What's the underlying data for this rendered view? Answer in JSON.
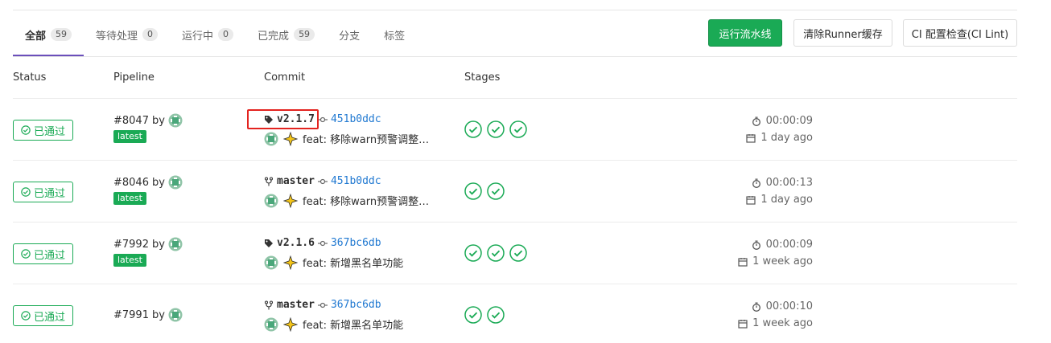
{
  "tabs": [
    {
      "label": "全部",
      "count": "59"
    },
    {
      "label": "等待处理",
      "count": "0"
    },
    {
      "label": "运行中",
      "count": "0"
    },
    {
      "label": "已完成",
      "count": "59"
    },
    {
      "label": "分支"
    },
    {
      "label": "标签"
    }
  ],
  "buttons": {
    "run_pipeline": "运行流水线",
    "clear_cache": "清除Runner缓存",
    "ci_lint": "CI 配置检查(CI Lint)"
  },
  "headers": {
    "status": "Status",
    "pipeline": "Pipeline",
    "commit": "Commit",
    "stages": "Stages"
  },
  "colors": {
    "success": "#1aaa55",
    "link": "#1f78d1",
    "highlight": "#e3231f"
  },
  "rows": [
    {
      "status": "已通过",
      "pipeline_id": "#8047",
      "by": "by",
      "latest": "latest",
      "ref_icon": "tag-icon",
      "ref": "v2.1.7",
      "sha": "451b0ddc",
      "title": "feat: 移除warn预警调整为i...",
      "stages": 3,
      "duration": "00:00:09",
      "finished": "1 day ago"
    },
    {
      "status": "已通过",
      "pipeline_id": "#8046",
      "by": "by",
      "latest": "latest",
      "ref_icon": "branch-icon",
      "ref": "master",
      "sha": "451b0ddc",
      "title": "feat: 移除warn预警调整为i...",
      "stages": 2,
      "duration": "00:00:13",
      "finished": "1 day ago"
    },
    {
      "status": "已通过",
      "pipeline_id": "#7992",
      "by": "by",
      "latest": "latest",
      "ref_icon": "tag-icon",
      "ref": "v2.1.6",
      "sha": "367bc6db",
      "title": "feat: 新增黑名单功能",
      "stages": 3,
      "duration": "00:00:09",
      "finished": "1 week ago"
    },
    {
      "status": "已通过",
      "pipeline_id": "#7991",
      "by": "by",
      "ref_icon": "branch-icon",
      "ref": "master",
      "sha": "367bc6db",
      "title": "feat: 新增黑名单功能",
      "stages": 2,
      "duration": "00:00:10",
      "finished": "1 week ago"
    }
  ]
}
